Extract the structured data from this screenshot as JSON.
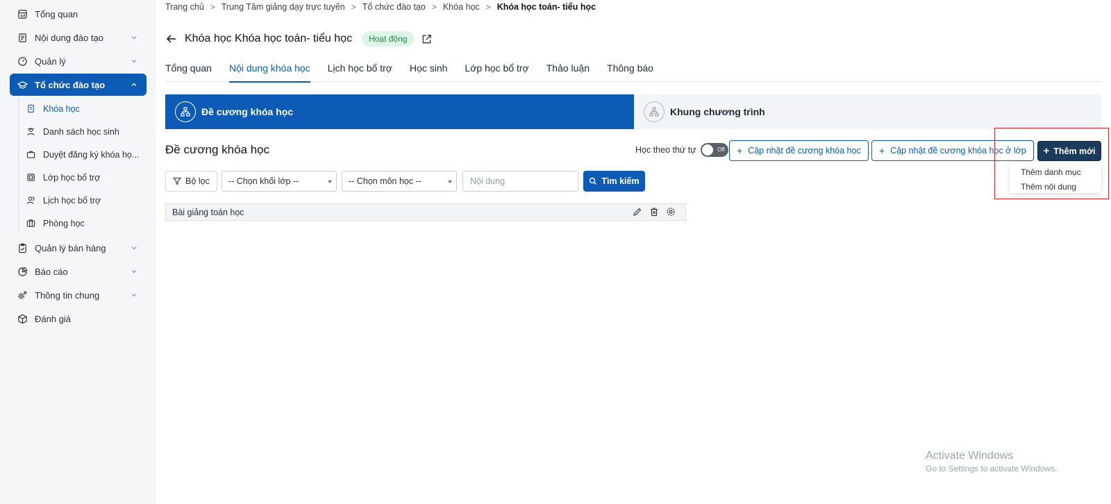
{
  "sidebar": {
    "items": [
      {
        "label": "Tổng quan",
        "icon": "dashboard-icon"
      },
      {
        "label": "Nội dung đào tạo",
        "icon": "document-icon"
      },
      {
        "label": "Quản lý",
        "icon": "gauge-icon"
      },
      {
        "label": "Tổ chức đào tạo",
        "icon": "graduation-cap-icon"
      },
      {
        "label": "Quản lý bán hàng",
        "icon": "clipboard-icon"
      },
      {
        "label": "Báo cáo",
        "icon": "pie-chart-icon"
      },
      {
        "label": "Thông tin chung",
        "icon": "settings-cog-icon"
      },
      {
        "label": "Đánh giá",
        "icon": "cube-icon"
      }
    ],
    "sub_items": [
      {
        "label": "Khóa học",
        "icon": "book-icon"
      },
      {
        "label": "Danh sách học sinh",
        "icon": "student-icon"
      },
      {
        "label": "Duyệt đăng ký khóa họ...",
        "icon": "briefcase-icon"
      },
      {
        "label": "Lớp học bổ trợ",
        "icon": "classroom-icon"
      },
      {
        "label": "Lịch học bổ trợ",
        "icon": "users-icon"
      },
      {
        "label": "Phòng học",
        "icon": "room-icon"
      }
    ]
  },
  "breadcrumb": {
    "items": [
      "Trang chủ",
      "Trung Tâm giảng dạy trực tuyến",
      "Tổ chức đào tạo",
      "Khóa học"
    ],
    "current": "Khóa học toán- tiểu học"
  },
  "header": {
    "title": "Khóa học Khóa học toán- tiểu học",
    "status": "Hoạt động"
  },
  "tabs": [
    "Tổng quan",
    "Nội dung khóa học",
    "Lịch học bổ trợ",
    "Học sinh",
    "Lớp học bổ trợ",
    "Thảo luận",
    "Thông báo"
  ],
  "sections": {
    "active": "Đề cương khóa học",
    "inactive": "Khung chương trình"
  },
  "toolbar": {
    "title": "Đề cương khóa học",
    "toggle_label": "Học theo thứ tự",
    "toggle_state": "Off",
    "update_outline_button": "Cập nhật đề cương khóa học",
    "update_class_outline_button": "Cập nhật đề cương khóa học ở lớp",
    "add_new_button": "Thêm mới",
    "add_menu": [
      "Thêm danh mục",
      "Thêm nội dung"
    ]
  },
  "filters": {
    "filter_button": "Bộ lọc",
    "grade_select": "-- Chọn khối lớp --",
    "subject_select": "-- Chọn môn học --",
    "content_placeholder": "Nội dung",
    "search_button": "Tìm kiếm"
  },
  "outline_items": [
    {
      "label": "Bài giảng toán học"
    }
  ],
  "watermark": {
    "line1": "Activate Windows",
    "line2": "Go to Settings to activate Windows."
  },
  "colors": {
    "primary": "#0d5bb5",
    "dark_button": "#1c3a5c",
    "status_bg": "#dcf5e7",
    "status_text": "#1a8a4a",
    "highlight": "#e02424"
  }
}
